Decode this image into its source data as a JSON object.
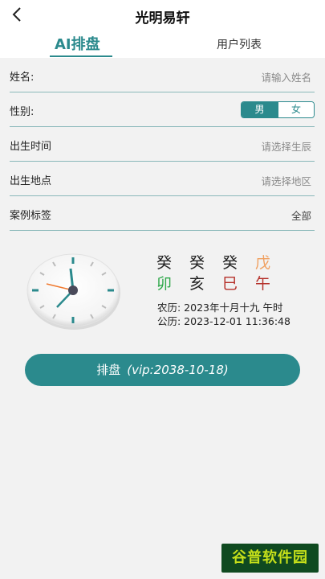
{
  "header": {
    "title": "光明易轩",
    "back_icon": "chevron-left-icon"
  },
  "tabs": [
    {
      "label": "AI排盘",
      "active": true
    },
    {
      "label": "用户列表",
      "active": false
    }
  ],
  "form": {
    "name": {
      "label": "姓名:",
      "placeholder": "请输入姓名"
    },
    "gender": {
      "label": "性别:",
      "options": [
        "男",
        "女"
      ],
      "selected": "男"
    },
    "birth_time": {
      "label": "出生时间",
      "placeholder": "请选择生辰"
    },
    "birth_place": {
      "label": "出生地点",
      "placeholder": "请选择地区"
    },
    "case_tag": {
      "label": "案例标签",
      "value": "全部"
    }
  },
  "bazi": {
    "stems": [
      "癸",
      "癸",
      "癸",
      "戊"
    ],
    "branches": [
      "卯",
      "亥",
      "巳",
      "午"
    ],
    "lunar": "农历: 2023年十月十九 午时",
    "solar": "公历: 2023-12-01 11:36:48"
  },
  "action": {
    "label": "排盘",
    "vip": "(vip:2038-10-18)"
  },
  "watermark": "谷普软件园",
  "colors": {
    "accent": "#2b8a8d",
    "metal_orange": "#f0a060",
    "wood_green": "#2ea84a",
    "fire_red": "#b5302a"
  }
}
